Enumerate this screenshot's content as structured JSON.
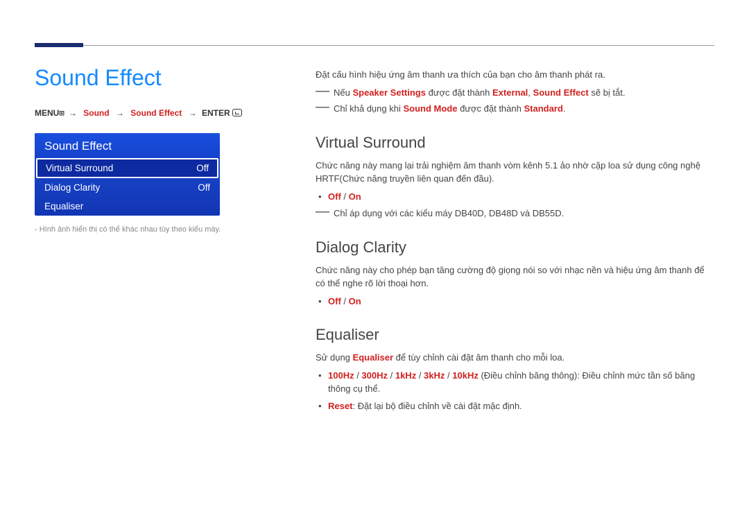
{
  "pageTitle": "Sound Effect",
  "breadcrumb": {
    "menu": "MENU",
    "sound": "Sound",
    "soundEffect": "Sound Effect",
    "enter": "ENTER"
  },
  "osd": {
    "header": "Sound Effect",
    "rows": [
      {
        "label": "Virtual Surround",
        "value": "Off"
      },
      {
        "label": "Dialog Clarity",
        "value": "Off"
      },
      {
        "label": "Equaliser",
        "value": ""
      }
    ]
  },
  "caption": "- Hình ảnh hiển thị có thể khác nhau tùy theo kiểu máy.",
  "intro": "Đặt cấu hình hiệu ứng âm thanh ưa thích của bạn cho âm thanh phát ra.",
  "note1": {
    "p1": "Nếu ",
    "b1": "Speaker Settings",
    "p2": " được đặt thành ",
    "b2": "External",
    "p3": ", ",
    "b3": "Sound Effect",
    "p4": " sẽ bị tắt."
  },
  "note2": {
    "p1": "Chỉ khả dụng khi ",
    "b1": "Sound Mode",
    "p2": " được đặt thành ",
    "b2": "Standard",
    "p3": "."
  },
  "virtual": {
    "title": "Virtual Surround",
    "desc": "Chức năng này mang lại trải nghiệm âm thanh vòm kênh 5.1 ảo nhờ cặp loa sử dụng công nghệ HRTF(Chức năng truyền liên quan đến đầu).",
    "opts": {
      "off": "Off",
      "sep": " / ",
      "on": "On"
    },
    "noteModels": "Chỉ áp dụng với các kiểu máy DB40D, DB48D và DB55D."
  },
  "dialog": {
    "title": "Dialog Clarity",
    "desc": "Chức năng này cho phép bạn tăng cường độ giọng nói so với nhạc nền và hiệu ứng âm thanh để có thể nghe rõ lời thoại hơn.",
    "opts": {
      "off": "Off",
      "sep": " / ",
      "on": "On"
    }
  },
  "equaliser": {
    "title": "Equaliser",
    "descPre": "Sử dụng ",
    "descBold": "Equaliser",
    "descPost": " để tùy chỉnh cài đặt âm thanh cho mỗi loa.",
    "bands": {
      "b1": "100Hz",
      "b2": "300Hz",
      "b3": "1kHz",
      "b4": "3kHz",
      "b5": "10kHz",
      "sep": " / "
    },
    "bandsDesc": " (Điều chỉnh băng thông): Điều chỉnh mức tần số băng thông cụ thể.",
    "resetLabel": "Reset",
    "resetDesc": ": Đặt lại bộ điều chỉnh về cài đặt mặc định."
  }
}
